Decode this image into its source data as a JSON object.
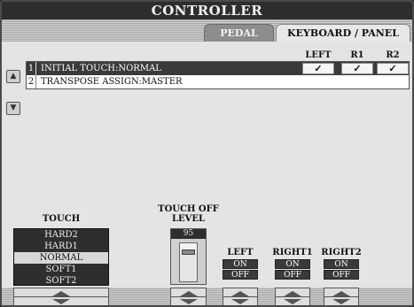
{
  "title": "CONTROLLER",
  "tabs": [
    {
      "label": "PEDAL",
      "active": false
    },
    {
      "label": "KEYBOARD / PANEL",
      "active": true
    }
  ],
  "columns": [
    "LEFT",
    "R1",
    "R2"
  ],
  "rows": [
    {
      "num": "1",
      "text": "INITIAL TOUCH:NORMAL",
      "selected": true,
      "checks": [
        "✓",
        "✓",
        "✓"
      ]
    },
    {
      "num": "2",
      "text": "TRANSPOSE ASSIGN:MASTER",
      "selected": false
    }
  ],
  "touch": {
    "label": "TOUCH",
    "options": [
      "HARD2",
      "HARD1",
      "NORMAL",
      "SOFT1",
      "SOFT2"
    ],
    "selected": "NORMAL"
  },
  "touch_off_level": {
    "label": "TOUCH OFF\nLEVEL",
    "value": "95",
    "fraction": 0.75
  },
  "parts": [
    {
      "label": "LEFT",
      "on": "ON",
      "off": "OFF"
    },
    {
      "label": "RIGHT1",
      "on": "ON",
      "off": "OFF"
    },
    {
      "label": "RIGHT2",
      "on": "ON",
      "off": "OFF"
    }
  ],
  "icons": {
    "scroll_up": "triangle-up-icon",
    "scroll_down": "triangle-down-icon",
    "check": "checkmark-icon"
  }
}
